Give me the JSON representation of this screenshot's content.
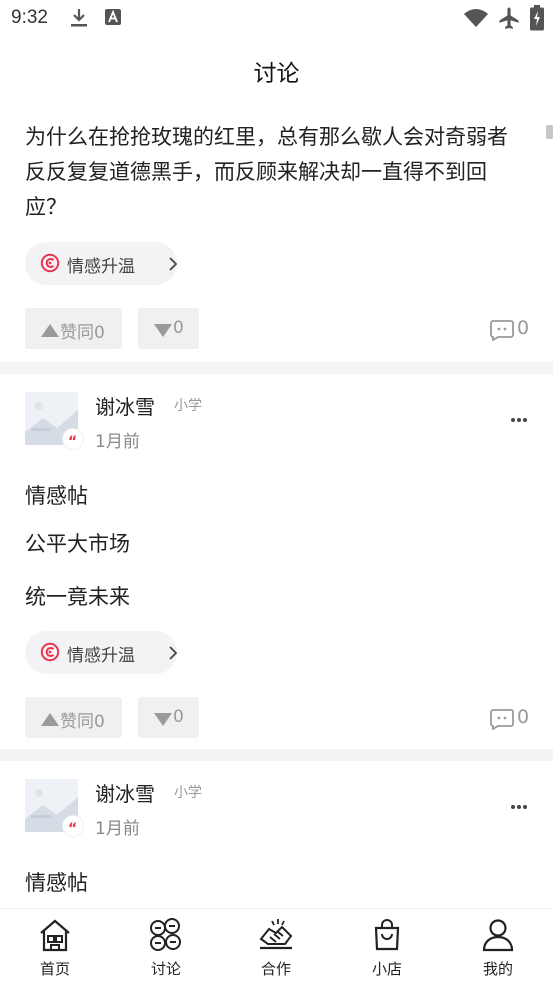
{
  "status_bar": {
    "time": "9:32",
    "left_icons": [
      "download-icon",
      "a-icon"
    ],
    "right_icons": [
      "wifi-icon",
      "airplane-icon",
      "battery-icon"
    ]
  },
  "header": {
    "title": "讨论"
  },
  "first_post": {
    "text": "为什么在抢抢玫瑰的红里，总有那么歇人会对奇弱者反反复复道德黑手，而反顾来解决却一直得不到回应？",
    "topic": "情感升温",
    "upvote": "赞同0",
    "downvote": "0",
    "comments": "0"
  },
  "posts": [
    {
      "user_name": "谢冰雪",
      "level": "小学",
      "time": "1月前",
      "title": "情感帖",
      "lines": [
        "公平大市场",
        "统一竟未来"
      ],
      "topic": "情感升温",
      "upvote": "赞同0",
      "downvote": "0",
      "comments": "0"
    },
    {
      "user_name": "谢冰雪",
      "level": "小学",
      "time": "1月前",
      "title": "情感帖"
    }
  ],
  "bottom_nav": {
    "items": [
      {
        "label": "首页",
        "icon": "home-icon"
      },
      {
        "label": "讨论",
        "icon": "discussion-icon"
      },
      {
        "label": "合作",
        "icon": "cooperation-icon"
      },
      {
        "label": "小店",
        "icon": "shop-bag-icon"
      },
      {
        "label": "我的",
        "icon": "profile-icon"
      }
    ]
  },
  "colors": {
    "accent_red": "#e8344e",
    "chip_bg": "#f3f3f5",
    "vote_bg": "#f0f0f2",
    "muted_text": "#999999"
  }
}
